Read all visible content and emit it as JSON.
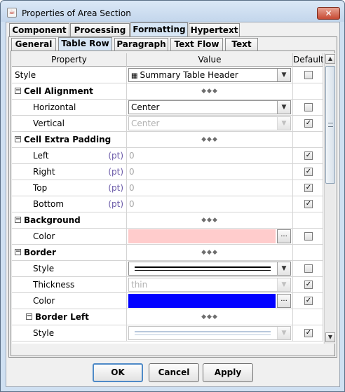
{
  "window": {
    "title": "Properties of Area Section",
    "close_label": "✕",
    "app_icon": "java-cup-icon"
  },
  "outer_tabs": [
    {
      "label": "Component",
      "selected": false
    },
    {
      "label": "Processing",
      "selected": false
    },
    {
      "label": "Formatting",
      "selected": true
    },
    {
      "label": "Hypertext",
      "selected": false
    }
  ],
  "inner_tabs": [
    {
      "label": "General",
      "selected": false
    },
    {
      "label": "Table Row",
      "selected": true
    },
    {
      "label": "Paragraph",
      "selected": false
    },
    {
      "label": "Text Flow",
      "selected": false
    },
    {
      "label": "Text",
      "selected": false
    }
  ],
  "table": {
    "headers": {
      "property": "Property",
      "value": "Value",
      "default": "Default"
    },
    "rows": [
      {
        "label": "Style",
        "value": "Summary Table Header",
        "type": "combo",
        "default": false
      },
      {
        "label": "Cell Alignment",
        "type": "group",
        "expanded": true,
        "marker": "◆◆◆"
      },
      {
        "label": "Horizontal",
        "value": "Center",
        "type": "combo",
        "default": false
      },
      {
        "label": "Vertical",
        "value": "Center",
        "type": "combo-disabled",
        "default": true
      },
      {
        "label": "Cell Extra Padding",
        "type": "group",
        "expanded": true,
        "marker": "◆◆◆"
      },
      {
        "label": "Left",
        "unit": "(pt)",
        "value": "0",
        "type": "text-disabled",
        "default": true
      },
      {
        "label": "Right",
        "unit": "(pt)",
        "value": "0",
        "type": "text-disabled",
        "default": true
      },
      {
        "label": "Top",
        "unit": "(pt)",
        "value": "0",
        "type": "text-disabled",
        "default": true
      },
      {
        "label": "Bottom",
        "unit": "(pt)",
        "value": "0",
        "type": "text-disabled",
        "default": true
      },
      {
        "label": "Background",
        "type": "group",
        "expanded": true,
        "marker": "◆◆◆"
      },
      {
        "label": "Color",
        "type": "color",
        "color": "#ffcccc",
        "button": "...",
        "default": false
      },
      {
        "label": "Border",
        "type": "group",
        "expanded": true,
        "marker": "◆◆◆"
      },
      {
        "label": "Style",
        "type": "line-combo",
        "line": "double",
        "default": false
      },
      {
        "label": "Thickness",
        "value": "thin",
        "type": "combo-disabled",
        "default": true
      },
      {
        "label": "Color",
        "type": "color",
        "color": "#0000ff",
        "button": "...",
        "default": true
      },
      {
        "label": "Border Left",
        "type": "subgroup",
        "expanded": true,
        "marker": "◆◆◆"
      },
      {
        "label": "Style",
        "type": "line-combo-disabled",
        "line": "double",
        "default": true
      }
    ]
  },
  "buttons": {
    "ok": "OK",
    "cancel": "Cancel",
    "apply": "Apply"
  },
  "colors": {
    "title_bg": "#cfe0f2",
    "selected_tab": "#d7e6f5",
    "default_button_border": "#4e8ac7"
  }
}
